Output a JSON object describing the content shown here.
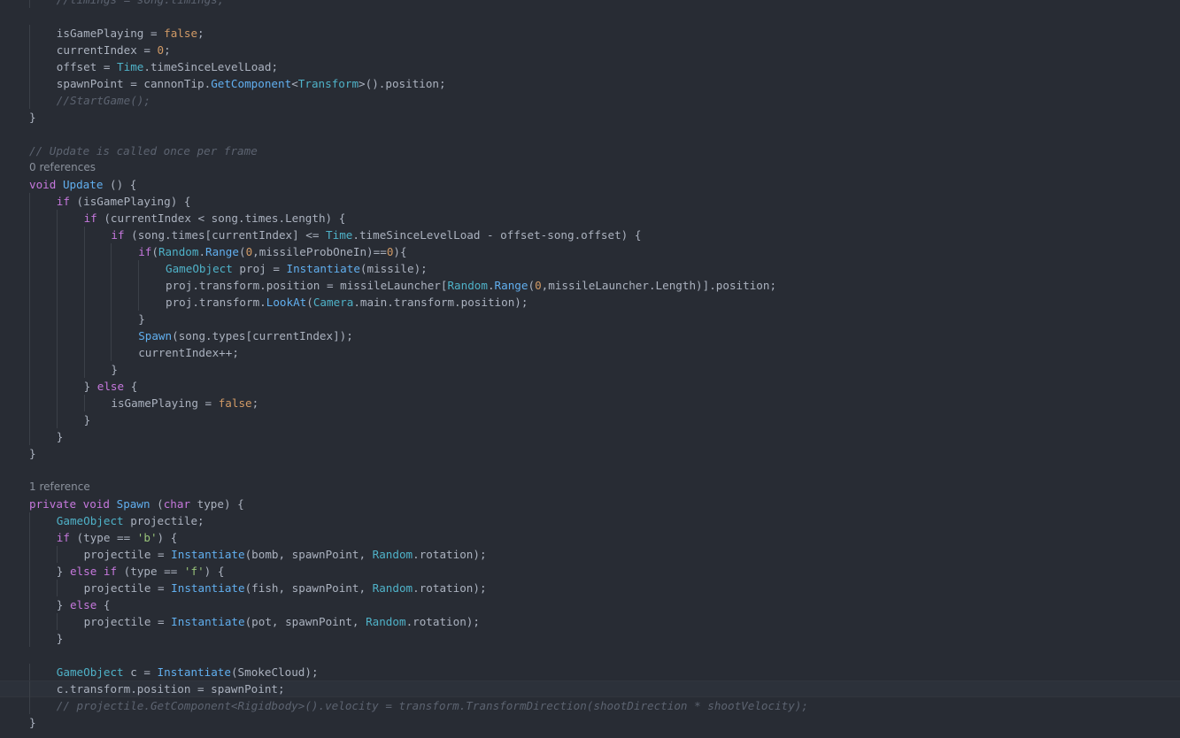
{
  "editor": {
    "colors": {
      "background": "#282c34",
      "current_line": "#2c313a",
      "keyword": "#c678dd",
      "function": "#61afef",
      "type": "#4fb2c8",
      "number": "#d19a66",
      "string": "#98c379",
      "comment": "#5c6370",
      "plain": "#abb2bf",
      "codelens": "#8a919c"
    },
    "lines": [
      {
        "indent": 1,
        "tokens": [
          [
            "//timings = song.timings;",
            "com"
          ]
        ]
      },
      {
        "indent": 0,
        "tokens": []
      },
      {
        "indent": 1,
        "tokens": [
          [
            "isGamePlaying = ",
            "pl"
          ],
          [
            "false",
            "num"
          ],
          [
            ";",
            "pl"
          ]
        ]
      },
      {
        "indent": 1,
        "tokens": [
          [
            "currentIndex = ",
            "pl"
          ],
          [
            "0",
            "num"
          ],
          [
            ";",
            "pl"
          ]
        ]
      },
      {
        "indent": 1,
        "tokens": [
          [
            "offset = ",
            "pl"
          ],
          [
            "Time",
            "ty"
          ],
          [
            ".timeSinceLevelLoad;",
            "pl"
          ]
        ]
      },
      {
        "indent": 1,
        "tokens": [
          [
            "spawnPoint = cannonTip.",
            "pl"
          ],
          [
            "GetComponent",
            "fn"
          ],
          [
            "<",
            "pl"
          ],
          [
            "Transform",
            "ty"
          ],
          [
            ">().position;",
            "pl"
          ]
        ]
      },
      {
        "indent": 1,
        "tokens": [
          [
            "//StartGame();",
            "com"
          ]
        ]
      },
      {
        "indent": 0,
        "tokens": [
          [
            "}",
            "pl"
          ]
        ]
      },
      {
        "indent": 0,
        "tokens": []
      },
      {
        "indent": 0,
        "tokens": [
          [
            "// Update is called once per frame",
            "com"
          ]
        ]
      },
      {
        "indent": 0,
        "lens": true,
        "tokens": [
          [
            "0 references",
            "lens"
          ]
        ]
      },
      {
        "indent": 0,
        "tokens": [
          [
            "void",
            "kw"
          ],
          [
            " ",
            "pl"
          ],
          [
            "Update",
            "fn"
          ],
          [
            " () {",
            "pl"
          ]
        ]
      },
      {
        "indent": 1,
        "tokens": [
          [
            "if",
            "kw"
          ],
          [
            " (isGamePlaying) {",
            "pl"
          ]
        ]
      },
      {
        "indent": 2,
        "tokens": [
          [
            "if",
            "kw"
          ],
          [
            " (currentIndex < song.times.Length) {",
            "pl"
          ]
        ]
      },
      {
        "indent": 3,
        "tokens": [
          [
            "if",
            "kw"
          ],
          [
            " (song.times[currentIndex] <= ",
            "pl"
          ],
          [
            "Time",
            "ty"
          ],
          [
            ".timeSinceLevelLoad - offset-song.offset) {",
            "pl"
          ]
        ]
      },
      {
        "indent": 4,
        "tokens": [
          [
            "if",
            "kw"
          ],
          [
            "(",
            "pl"
          ],
          [
            "Random",
            "ty"
          ],
          [
            ".",
            "pl"
          ],
          [
            "Range",
            "fn"
          ],
          [
            "(",
            "pl"
          ],
          [
            "0",
            "num"
          ],
          [
            ",missileProbOneIn)==",
            "pl"
          ],
          [
            "0",
            "num"
          ],
          [
            "){",
            "pl"
          ]
        ]
      },
      {
        "indent": 5,
        "tokens": [
          [
            "GameObject",
            "ty"
          ],
          [
            " proj = ",
            "pl"
          ],
          [
            "Instantiate",
            "fn"
          ],
          [
            "(missile);",
            "pl"
          ]
        ]
      },
      {
        "indent": 5,
        "tokens": [
          [
            "proj.transform.position = missileLauncher[",
            "pl"
          ],
          [
            "Random",
            "ty"
          ],
          [
            ".",
            "pl"
          ],
          [
            "Range",
            "fn"
          ],
          [
            "(",
            "pl"
          ],
          [
            "0",
            "num"
          ],
          [
            ",missileLauncher.Length)].position;",
            "pl"
          ]
        ]
      },
      {
        "indent": 5,
        "tokens": [
          [
            "proj.transform.",
            "pl"
          ],
          [
            "LookAt",
            "fn"
          ],
          [
            "(",
            "pl"
          ],
          [
            "Camera",
            "ty"
          ],
          [
            ".main.transform.position);",
            "pl"
          ]
        ]
      },
      {
        "indent": 4,
        "tokens": [
          [
            "}",
            "pl"
          ]
        ]
      },
      {
        "indent": 4,
        "tokens": [
          [
            "Spawn",
            "fn"
          ],
          [
            "(song.types[currentIndex]);",
            "pl"
          ]
        ]
      },
      {
        "indent": 4,
        "tokens": [
          [
            "currentIndex++;",
            "pl"
          ]
        ]
      },
      {
        "indent": 3,
        "tokens": [
          [
            "}",
            "pl"
          ]
        ]
      },
      {
        "indent": 2,
        "tokens": [
          [
            "} ",
            "pl"
          ],
          [
            "else",
            "kw"
          ],
          [
            " {",
            "pl"
          ]
        ]
      },
      {
        "indent": 3,
        "tokens": [
          [
            "isGamePlaying = ",
            "pl"
          ],
          [
            "false",
            "num"
          ],
          [
            ";",
            "pl"
          ]
        ]
      },
      {
        "indent": 2,
        "tokens": [
          [
            "}",
            "pl"
          ]
        ]
      },
      {
        "indent": 1,
        "tokens": [
          [
            "}",
            "pl"
          ]
        ]
      },
      {
        "indent": 0,
        "tokens": [
          [
            "}",
            "pl"
          ]
        ]
      },
      {
        "indent": 0,
        "tokens": []
      },
      {
        "indent": 0,
        "lens": true,
        "tokens": [
          [
            "1 reference",
            "lens"
          ]
        ]
      },
      {
        "indent": 0,
        "tokens": [
          [
            "private",
            "kw"
          ],
          [
            " ",
            "pl"
          ],
          [
            "void",
            "kw"
          ],
          [
            " ",
            "pl"
          ],
          [
            "Spawn",
            "fn"
          ],
          [
            " (",
            "pl"
          ],
          [
            "char",
            "kw"
          ],
          [
            " type) {",
            "pl"
          ]
        ]
      },
      {
        "indent": 1,
        "tokens": [
          [
            "GameObject",
            "ty"
          ],
          [
            " projectile;",
            "pl"
          ]
        ]
      },
      {
        "indent": 1,
        "tokens": [
          [
            "if",
            "kw"
          ],
          [
            " (type == ",
            "pl"
          ],
          [
            "'b'",
            "str"
          ],
          [
            ") {",
            "pl"
          ]
        ]
      },
      {
        "indent": 2,
        "tokens": [
          [
            "projectile = ",
            "pl"
          ],
          [
            "Instantiate",
            "fn"
          ],
          [
            "(bomb, spawnPoint, ",
            "pl"
          ],
          [
            "Random",
            "ty"
          ],
          [
            ".rotation);",
            "pl"
          ]
        ]
      },
      {
        "indent": 1,
        "tokens": [
          [
            "} ",
            "pl"
          ],
          [
            "else",
            "kw"
          ],
          [
            " ",
            "pl"
          ],
          [
            "if",
            "kw"
          ],
          [
            " (type == ",
            "pl"
          ],
          [
            "'f'",
            "str"
          ],
          [
            ") {",
            "pl"
          ]
        ]
      },
      {
        "indent": 2,
        "tokens": [
          [
            "projectile = ",
            "pl"
          ],
          [
            "Instantiate",
            "fn"
          ],
          [
            "(fish, spawnPoint, ",
            "pl"
          ],
          [
            "Random",
            "ty"
          ],
          [
            ".rotation);",
            "pl"
          ]
        ]
      },
      {
        "indent": 1,
        "tokens": [
          [
            "} ",
            "pl"
          ],
          [
            "else",
            "kw"
          ],
          [
            " {",
            "pl"
          ]
        ]
      },
      {
        "indent": 2,
        "tokens": [
          [
            "projectile = ",
            "pl"
          ],
          [
            "Instantiate",
            "fn"
          ],
          [
            "(pot, spawnPoint, ",
            "pl"
          ],
          [
            "Random",
            "ty"
          ],
          [
            ".rotation);",
            "pl"
          ]
        ]
      },
      {
        "indent": 1,
        "tokens": [
          [
            "}",
            "pl"
          ]
        ]
      },
      {
        "indent": 0,
        "tokens": []
      },
      {
        "indent": 1,
        "tokens": [
          [
            "GameObject",
            "ty"
          ],
          [
            " c = ",
            "pl"
          ],
          [
            "Instantiate",
            "fn"
          ],
          [
            "(SmokeCloud);",
            "pl"
          ]
        ]
      },
      {
        "indent": 1,
        "current": true,
        "tokens": [
          [
            "c.transform.position = spawnPoint;",
            "pl"
          ]
        ]
      },
      {
        "indent": 1,
        "tokens": [
          [
            "// projectile.GetComponent<Rigidbody>().velocity = transform.TransformDirection(shootDirection * shootVelocity);",
            "com"
          ]
        ]
      },
      {
        "indent": 0,
        "tokens": [
          [
            "}",
            "pl"
          ]
        ]
      }
    ]
  }
}
